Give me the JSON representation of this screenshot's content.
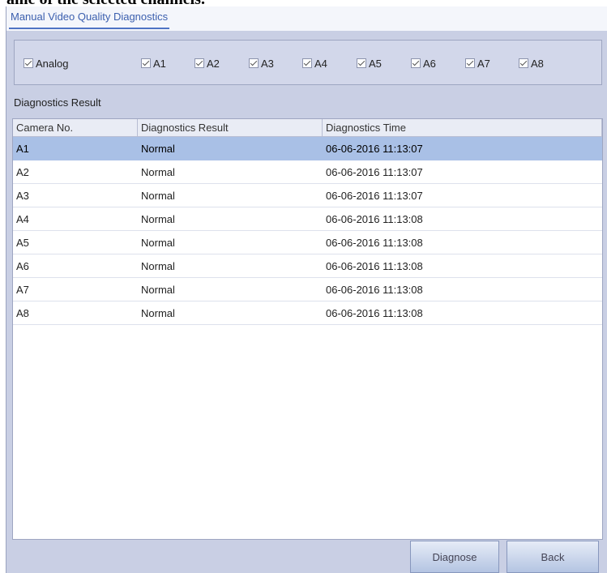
{
  "header_snippet": "ame of the selected channels.",
  "tab": {
    "label": "Manual Video Quality Diagnostics"
  },
  "channels": {
    "analog": {
      "label": "Analog",
      "checked": true
    },
    "items": [
      {
        "label": "A1",
        "checked": true
      },
      {
        "label": "A2",
        "checked": true
      },
      {
        "label": "A3",
        "checked": true
      },
      {
        "label": "A4",
        "checked": true
      },
      {
        "label": "A5",
        "checked": true
      },
      {
        "label": "A6",
        "checked": true
      },
      {
        "label": "A7",
        "checked": true
      },
      {
        "label": "A8",
        "checked": true
      }
    ]
  },
  "section": {
    "label": "Diagnostics Result"
  },
  "table": {
    "headers": [
      "Camera No.",
      "Diagnostics Result",
      "Diagnostics Time"
    ],
    "rows": [
      [
        "A1",
        "Normal",
        "06-06-2016 11:13:07"
      ],
      [
        "A2",
        "Normal",
        "06-06-2016 11:13:07"
      ],
      [
        "A3",
        "Normal",
        "06-06-2016 11:13:07"
      ],
      [
        "A4",
        "Normal",
        "06-06-2016 11:13:08"
      ],
      [
        "A5",
        "Normal",
        "06-06-2016 11:13:08"
      ],
      [
        "A6",
        "Normal",
        "06-06-2016 11:13:08"
      ],
      [
        "A7",
        "Normal",
        "06-06-2016 11:13:08"
      ],
      [
        "A8",
        "Normal",
        "06-06-2016 11:13:08"
      ]
    ],
    "selected_row": 0
  },
  "buttons": {
    "diagnose": "Diagnose",
    "back": "Back"
  },
  "colors": {
    "panel": "#c9cfe4",
    "accent": "#3b5fae",
    "selected_row": "#a9c0e6"
  }
}
